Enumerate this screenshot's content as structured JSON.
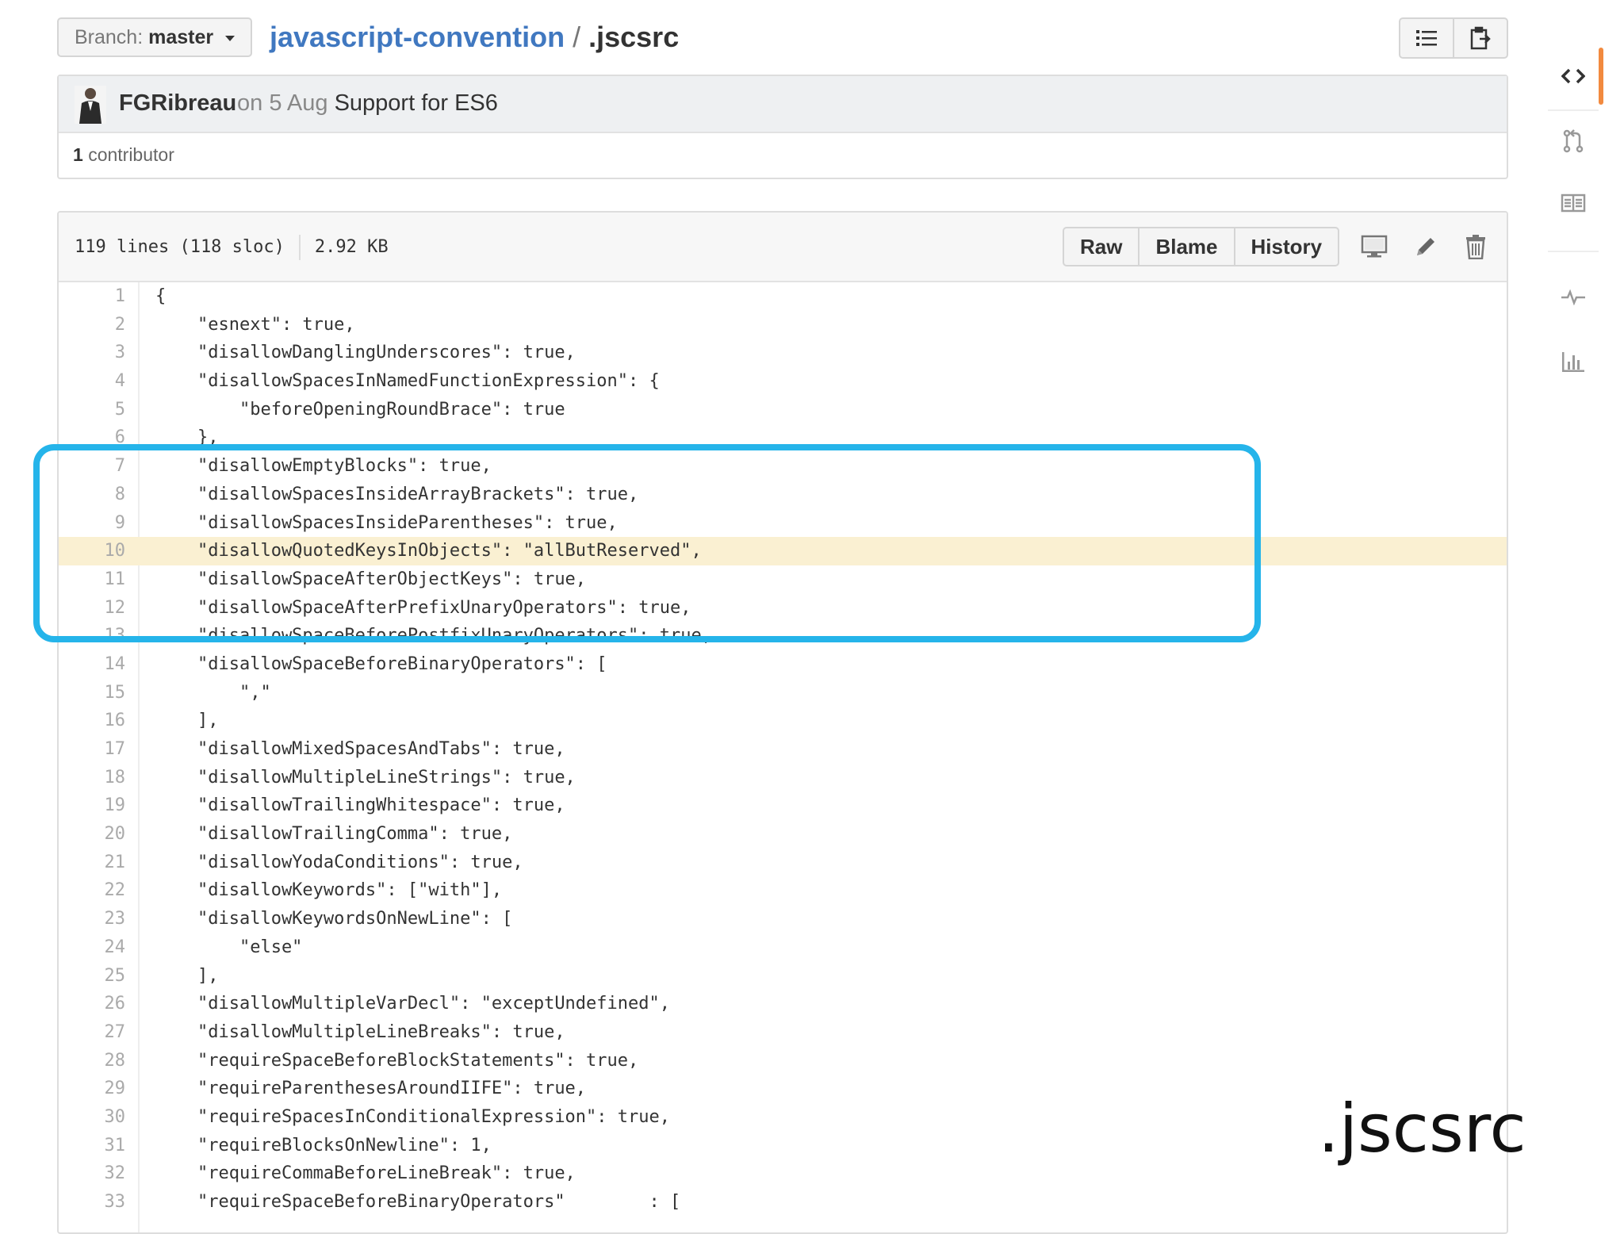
{
  "branch": {
    "prefix": "Branch:",
    "name": "master"
  },
  "breadcrumb": {
    "repo": "javascript-convention",
    "separator": "/",
    "file": ".jscsrc"
  },
  "commit": {
    "author": "FGRibreau",
    "date": "on 5 Aug",
    "message": "Support for ES6",
    "contributor_count": "1",
    "contributor_label": "contributor"
  },
  "file": {
    "lines_info": "119 lines (118 sloc)",
    "size": "2.92 KB",
    "raw_label": "Raw",
    "blame_label": "Blame",
    "history_label": "History",
    "highlighted_line": "10"
  },
  "code_lines": [
    {
      "n": "1",
      "text": "{"
    },
    {
      "n": "2",
      "text": "    \"esnext\": true,"
    },
    {
      "n": "3",
      "text": "    \"disallowDanglingUnderscores\": true,"
    },
    {
      "n": "4",
      "text": "    \"disallowSpacesInNamedFunctionExpression\": {"
    },
    {
      "n": "5",
      "text": "        \"beforeOpeningRoundBrace\": true"
    },
    {
      "n": "6",
      "text": "    },"
    },
    {
      "n": "7",
      "text": "    \"disallowEmptyBlocks\": true,"
    },
    {
      "n": "8",
      "text": "    \"disallowSpacesInsideArrayBrackets\": true,"
    },
    {
      "n": "9",
      "text": "    \"disallowSpacesInsideParentheses\": true,"
    },
    {
      "n": "10",
      "text": "    \"disallowQuotedKeysInObjects\": \"allButReserved\","
    },
    {
      "n": "11",
      "text": "    \"disallowSpaceAfterObjectKeys\": true,"
    },
    {
      "n": "12",
      "text": "    \"disallowSpaceAfterPrefixUnaryOperators\": true,"
    },
    {
      "n": "13",
      "text": "    \"disallowSpaceBeforePostfixUnaryOperators\": true,"
    },
    {
      "n": "14",
      "text": "    \"disallowSpaceBeforeBinaryOperators\": ["
    },
    {
      "n": "15",
      "text": "        \",\""
    },
    {
      "n": "16",
      "text": "    ],"
    },
    {
      "n": "17",
      "text": "    \"disallowMixedSpacesAndTabs\": true,"
    },
    {
      "n": "18",
      "text": "    \"disallowMultipleLineStrings\": true,"
    },
    {
      "n": "19",
      "text": "    \"disallowTrailingWhitespace\": true,"
    },
    {
      "n": "20",
      "text": "    \"disallowTrailingComma\": true,"
    },
    {
      "n": "21",
      "text": "    \"disallowYodaConditions\": true,"
    },
    {
      "n": "22",
      "text": "    \"disallowKeywords\": [\"with\"],"
    },
    {
      "n": "23",
      "text": "    \"disallowKeywordsOnNewLine\": ["
    },
    {
      "n": "24",
      "text": "        \"else\""
    },
    {
      "n": "25",
      "text": "    ],"
    },
    {
      "n": "26",
      "text": "    \"disallowMultipleVarDecl\": \"exceptUndefined\","
    },
    {
      "n": "27",
      "text": "    \"disallowMultipleLineBreaks\": true,"
    },
    {
      "n": "28",
      "text": "    \"requireSpaceBeforeBlockStatements\": true,"
    },
    {
      "n": "29",
      "text": "    \"requireParenthesesAroundIIFE\": true,"
    },
    {
      "n": "30",
      "text": "    \"requireSpacesInConditionalExpression\": true,"
    },
    {
      "n": "31",
      "text": "    \"requireBlocksOnNewline\": 1,"
    },
    {
      "n": "32",
      "text": "    \"requireCommaBeforeLineBreak\": true,"
    },
    {
      "n": "33",
      "text": "    \"requireSpaceBeforeBinaryOperators\"        : ["
    }
  ],
  "slide_caption": ".jscsrc",
  "colors": {
    "link": "#4078c0",
    "highlight_box": "#25b4ea",
    "highlighted_row": "#faf0d2",
    "rail_active": "#f28a3f"
  },
  "icons": {
    "top_toolbar": [
      "list-icon",
      "clipboard-icon"
    ],
    "file_actions": [
      "desktop-icon",
      "pencil-icon",
      "trash-icon"
    ],
    "rail": [
      "code-icon",
      "pull-request-icon",
      "book-icon",
      "pulse-icon",
      "graph-icon"
    ]
  }
}
